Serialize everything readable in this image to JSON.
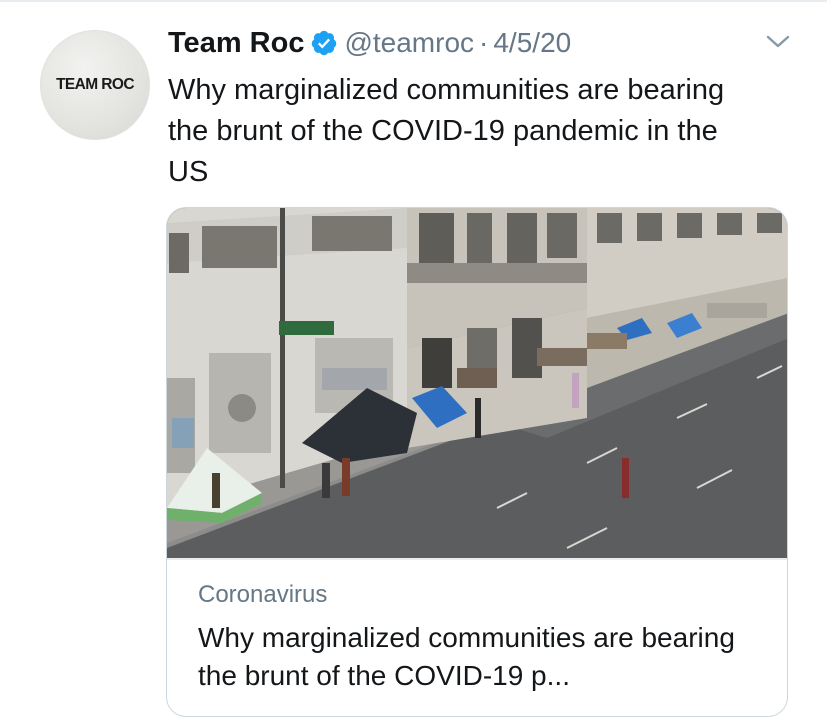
{
  "avatar": {
    "text": "TEAM ROC"
  },
  "header": {
    "display_name": "Team Roc",
    "verified_icon": "verified-badge-icon",
    "handle": "@teamroc",
    "separator": "·",
    "date": "4/5/20",
    "menu_icon": "chevron-down-icon"
  },
  "tweet": {
    "text": "Why marginalized communities are bearing the brunt of the COVID-19 pandemic in the US"
  },
  "card": {
    "image_description_icon": "street-photo-image",
    "category": "Coronavirus",
    "title": "Why marginalized communities are bearing the brunt of the COVID-19 p..."
  },
  "colors": {
    "text_primary": "#14171a",
    "text_secondary": "#657786",
    "verified_blue": "#1da1f2",
    "border": "#ccd6dd"
  }
}
